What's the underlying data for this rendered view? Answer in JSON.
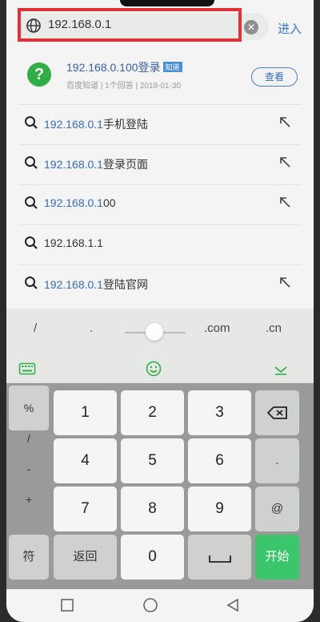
{
  "address_bar": {
    "url": "192.168.0.1",
    "enter_label": "进入"
  },
  "card": {
    "title_highlight": "192.168.0.1",
    "title_rest": "00登录",
    "tag": "知道",
    "meta": "百度知道 | 1个回答 | 2018-01-30",
    "button": "查看"
  },
  "suggestions": [
    {
      "highlight": "192.168.0.1",
      "rest": "手机登陆"
    },
    {
      "highlight": "192.168.0.1",
      "rest": "登录页面"
    },
    {
      "highlight": "192.168.0.1",
      "rest": "00"
    },
    {
      "highlight": "",
      "rest": "192.168.1.1"
    },
    {
      "highlight": "192.168.0.1",
      "rest": "登陆官网"
    }
  ],
  "keyboard": {
    "quick_keys": [
      "/",
      ".",
      ".com",
      ".cn"
    ],
    "left_col": [
      "%",
      "/",
      "-",
      "+"
    ],
    "digits": [
      "1",
      "2",
      "3",
      "4",
      "5",
      "6",
      "7",
      "8",
      "9",
      "0"
    ],
    "dot_key": ".",
    "at_key": "@",
    "symbol_key": "符",
    "back_key": "返回",
    "space_key": "␣",
    "start_key": "开始"
  },
  "colors": {
    "highlight_box": "#e03236",
    "start_key": "#3cc66c",
    "link": "#3a6ab8"
  }
}
